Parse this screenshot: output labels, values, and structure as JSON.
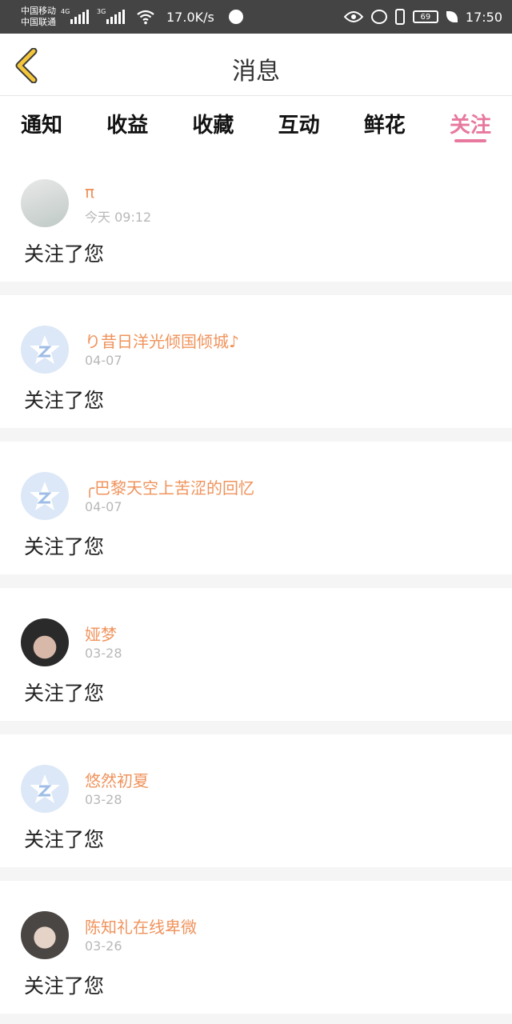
{
  "status_bar": {
    "carrier1": "中国移动",
    "carrier2": "中国联通",
    "net1": "4G",
    "net2": "3G",
    "speed": "17.0K/s",
    "battery": "69",
    "time": "17:50"
  },
  "header": {
    "title": "消息"
  },
  "tabs": [
    {
      "label": "通知",
      "active": false
    },
    {
      "label": "收益",
      "active": false
    },
    {
      "label": "收藏",
      "active": false
    },
    {
      "label": "互动",
      "active": false
    },
    {
      "label": "鲜花",
      "active": false
    },
    {
      "label": "关注",
      "active": true
    }
  ],
  "messages": [
    {
      "name": "π",
      "time": "今天 09:12",
      "text": "关注了您",
      "avatar": "photo"
    },
    {
      "name": "り昔日洋光倾国倾城♪",
      "time": "04-07",
      "text": "关注了您",
      "avatar": "default"
    },
    {
      "name": "╭巴黎天空上苦涩的回忆",
      "time": "04-07",
      "text": "关注了您",
      "avatar": "default"
    },
    {
      "name": "娅梦",
      "time": "03-28",
      "text": "关注了您",
      "avatar": "photo"
    },
    {
      "name": "悠然初夏",
      "time": "03-28",
      "text": "关注了您",
      "avatar": "default"
    },
    {
      "name": "陈知礼在线卑微",
      "time": "03-26",
      "text": "关注了您",
      "avatar": "photo"
    }
  ],
  "colors": {
    "accent": "#e8789f",
    "name": "#f0935c",
    "back_icon": "#f3c63b"
  }
}
